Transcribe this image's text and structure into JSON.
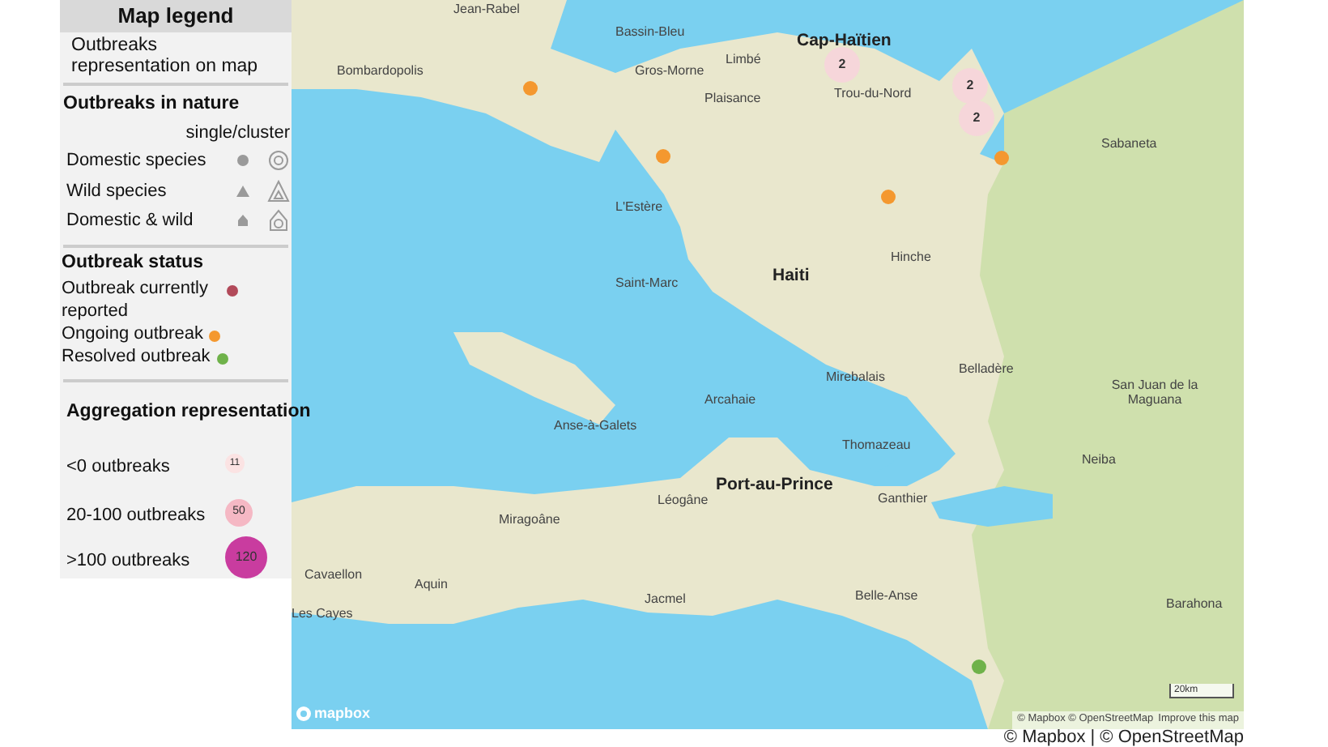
{
  "legend": {
    "title": "Map legend",
    "subtitle": "Outbreaks representation on map",
    "nature": {
      "heading": "Outbreaks in nature",
      "column_header": "single/cluster",
      "rows": [
        {
          "label": "Domestic species",
          "kind": "domestic"
        },
        {
          "label": "Wild species",
          "kind": "wild"
        },
        {
          "label": "Domestic & wild",
          "kind": "both"
        }
      ]
    },
    "status": {
      "heading": "Outbreak status",
      "rows": [
        {
          "label": "Outbreak currently reported",
          "color": "#b24a5a"
        },
        {
          "label": "Ongoing outbreak",
          "color": "#f4982f"
        },
        {
          "label": "Resolved outbreak",
          "color": "#6fb24a"
        }
      ]
    },
    "aggregation": {
      "heading": "Aggregation representation",
      "rows": [
        {
          "label": "<0 outbreaks",
          "count": "11",
          "color": "#fbe3e3"
        },
        {
          "label": "20-100 outbreaks",
          "count": "50",
          "color": "#f5b8c4"
        },
        {
          "label": ">100 outbreaks",
          "count": "120",
          "color": "#c93c9f"
        }
      ]
    }
  },
  "map": {
    "labels": [
      "Jean-Rabel",
      "Bassin-Bleu",
      "Bombardopolis",
      "Limbé",
      "Gros-Morne",
      "Plaisance",
      "Cap-Haïtien",
      "Trou-du-Nord",
      "Sabaneta",
      "L'Estère",
      "Saint-Marc",
      "Haiti",
      "Hinche",
      "Arcahaie",
      "Anse-à-Galets",
      "Mirebalais",
      "Belladère",
      "San Juan de la Maguana",
      "Thomazeau",
      "Port-au-Prince",
      "Ganthier",
      "Neiba",
      "Léogâne",
      "Miragoâne",
      "Aquin",
      "Cavaellon",
      "Les Cayes",
      "Jacmel",
      "Belle-Anse",
      "Barahona"
    ],
    "markers": [
      {
        "kind": "single",
        "color": "#f4982f"
      },
      {
        "kind": "single",
        "color": "#f4982f"
      },
      {
        "kind": "single",
        "color": "#f4982f"
      },
      {
        "kind": "single",
        "color": "#f4982f"
      },
      {
        "kind": "single",
        "color": "#6fb24a"
      },
      {
        "kind": "cluster",
        "color": "#f6d6da",
        "count": "2"
      },
      {
        "kind": "cluster",
        "color": "#f6d6da",
        "count": "2"
      },
      {
        "kind": "cluster",
        "color": "#f6d6da",
        "count": "2"
      }
    ],
    "logo": "mapbox",
    "scale": "20km",
    "attribution": "© Mapbox © OpenStreetMap",
    "improve_link": "Improve this map"
  },
  "footer_attribution": "© Mapbox | © OpenStreetMap"
}
